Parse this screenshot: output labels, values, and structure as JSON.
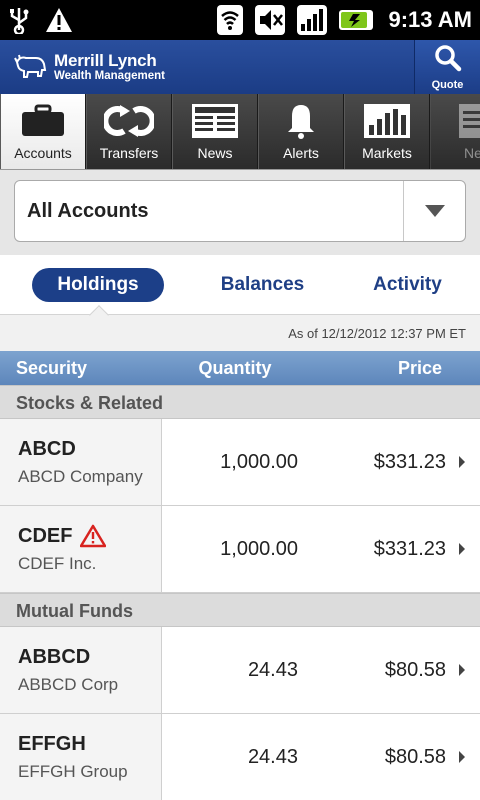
{
  "status_bar": {
    "time": "9:13 AM",
    "icons": [
      "usb-icon",
      "warning-icon",
      "wifi-icon",
      "mute-icon",
      "signal-icon",
      "battery-charging-icon"
    ]
  },
  "header": {
    "brand_name": "Merrill Lynch",
    "brand_sub": "Wealth Management",
    "quote_label": "Quote",
    "colors": {
      "primary": "#1c3f88",
      "accent": "#6b93c6"
    }
  },
  "nav": {
    "tabs": [
      {
        "label": "Accounts",
        "icon": "briefcase-icon",
        "active": true
      },
      {
        "label": "Transfers",
        "icon": "transfer-arrows-icon"
      },
      {
        "label": "News",
        "icon": "newspaper-icon"
      },
      {
        "label": "Alerts",
        "icon": "bell-icon"
      },
      {
        "label": "Markets",
        "icon": "bar-chart-icon"
      },
      {
        "label": "Ne",
        "icon": "notepad-icon"
      }
    ]
  },
  "account_selector": {
    "value": "All Accounts"
  },
  "segments": {
    "holdings": "Holdings",
    "balances": "Balances",
    "activity": "Activity"
  },
  "as_of": "As of 12/12/2012 12:37 PM ET",
  "table": {
    "columns": {
      "security": "Security",
      "quantity": "Quantity",
      "price": "Price"
    },
    "sections": [
      {
        "title": "Stocks & Related",
        "rows": [
          {
            "symbol": "ABCD",
            "name": "ABCD Company",
            "quantity": "1,000.00",
            "price": "$331.23",
            "warning": false
          },
          {
            "symbol": "CDEF",
            "name": "CDEF Inc.",
            "quantity": "1,000.00",
            "price": "$331.23",
            "warning": true
          }
        ]
      },
      {
        "title": "Mutual Funds",
        "rows": [
          {
            "symbol": "ABBCD",
            "name": "ABBCD Corp",
            "quantity": "24.43",
            "price": "$80.58",
            "warning": false
          },
          {
            "symbol": "EFFGH",
            "name": "EFFGH Group",
            "quantity": "24.43",
            "price": "$80.58",
            "warning": false
          }
        ]
      }
    ]
  }
}
